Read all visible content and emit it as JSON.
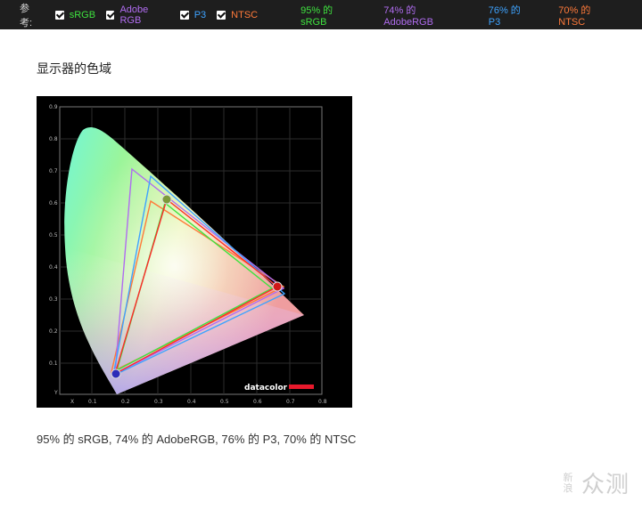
{
  "topbar": {
    "ref_label": "参考:",
    "checks": [
      {
        "label": "sRGB",
        "color": "#3fe23f"
      },
      {
        "label": "Adobe RGB",
        "color": "#b06cf0"
      },
      {
        "label": "P3",
        "color": "#3ea3ff"
      },
      {
        "label": "NTSC",
        "color": "#ff7a3a"
      }
    ],
    "stats": [
      {
        "text": "95% 的 sRGB",
        "color": "#3fe23f"
      },
      {
        "text": "74% 的 AdobeRGB",
        "color": "#b06cf0"
      },
      {
        "text": "76% 的 P3",
        "color": "#3ea3ff"
      },
      {
        "text": "70% 的 NTSC",
        "color": "#ff7a3a"
      }
    ]
  },
  "content": {
    "heading": "显示器的色域",
    "caption": "95% 的 sRGB, 74% 的 AdobeRGB, 76% 的 P3, 70% 的 NTSC"
  },
  "figure": {
    "brand": "datacolor",
    "x_axis_title": "X",
    "y_axis_title": "Y",
    "x_ticks": [
      "0.1",
      "0.2",
      "0.3",
      "0.4",
      "0.5",
      "0.6",
      "0.7",
      "0.8"
    ],
    "y_ticks": [
      "0.1",
      "0.2",
      "0.3",
      "0.4",
      "0.5",
      "0.6",
      "0.7",
      "0.8",
      "0.9"
    ]
  },
  "watermark": {
    "small_top": "新",
    "small_bottom": "浪",
    "big": "众测"
  }
}
